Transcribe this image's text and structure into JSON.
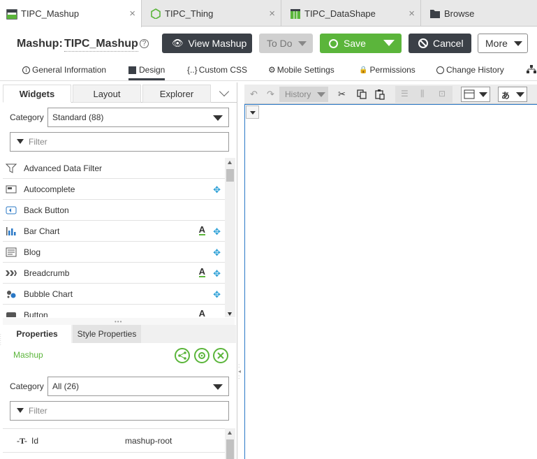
{
  "tabs": [
    {
      "label": "TIPC_Mashup",
      "icon": "mashup-icon",
      "close": "×"
    },
    {
      "label": "TIPC_Thing",
      "icon": "thing-icon",
      "close": "×"
    },
    {
      "label": "TIPC_DataShape",
      "icon": "datashape-icon",
      "close": "×"
    },
    {
      "label": "Browse",
      "icon": "folder-icon"
    }
  ],
  "header": {
    "type_label": "Mashup:",
    "name": "TIPC_Mashup",
    "help": "?"
  },
  "actions": {
    "view_mashup": "View Mashup",
    "todo": "To Do",
    "save": "Save",
    "cancel": "Cancel",
    "more": "More"
  },
  "subtabs": [
    "General Information",
    "Design",
    "Custom CSS",
    "Mobile Settings",
    "Permissions",
    "Change History"
  ],
  "subtab_icons": [
    "info-icon",
    "design-icon",
    "css-icon",
    "gear-icon",
    "lock-icon",
    "clock-icon"
  ],
  "widgets_panel": {
    "tabs": [
      "Widgets",
      "Layout",
      "Explorer"
    ],
    "category_label": "Category",
    "category_value": "Standard (88)",
    "filter_placeholder": "Filter",
    "items": [
      {
        "label": "Advanced Data Filter",
        "icon": "filter-widget-icon",
        "a": false,
        "move": false
      },
      {
        "label": "Autocomplete",
        "icon": "autocomplete-icon",
        "a": false,
        "move": true
      },
      {
        "label": "Back Button",
        "icon": "back-button-icon",
        "a": false,
        "move": false
      },
      {
        "label": "Bar Chart",
        "icon": "bar-chart-icon",
        "a": true,
        "move": true
      },
      {
        "label": "Blog",
        "icon": "blog-icon",
        "a": false,
        "move": true
      },
      {
        "label": "Breadcrumb",
        "icon": "breadcrumb-icon",
        "a": true,
        "move": true
      },
      {
        "label": "Bubble Chart",
        "icon": "bubble-chart-icon",
        "a": false,
        "move": true
      },
      {
        "label": "Button",
        "icon": "button-icon",
        "a": true,
        "move": false
      }
    ],
    "a_glyph": "A",
    "move_glyph": "✥"
  },
  "properties_panel": {
    "tabs": [
      "Properties",
      "Style Properties"
    ],
    "selected": "Mashup",
    "category_label": "Category",
    "category_value": "All (26)",
    "filter_placeholder": "Filter",
    "rows": [
      {
        "name": "Id",
        "value": "mashup-root"
      }
    ]
  },
  "canvas_toolbar": {
    "history": "History"
  }
}
